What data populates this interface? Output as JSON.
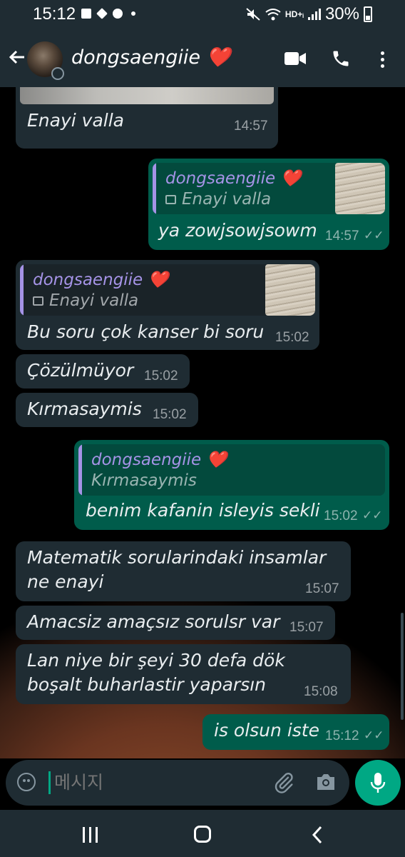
{
  "status_bar": {
    "time": "15:12",
    "network": "HD+ᵢ",
    "battery": "30%"
  },
  "header": {
    "contact_name": "dongsaengiie",
    "contact_emoji": "❤️"
  },
  "messages": [
    {
      "id": "m0",
      "dir": "in",
      "text": "Enayi valla",
      "time": "14:57"
    },
    {
      "id": "m1",
      "dir": "out",
      "reply_name": "dongsaengiie",
      "reply_emoji": "❤️",
      "reply_text": "Enayi valla",
      "text": "ya zowjsowjsowm",
      "time": "14:57"
    },
    {
      "id": "m2",
      "dir": "in",
      "reply_name": "dongsaengiie",
      "reply_emoji": "❤️",
      "reply_text": "Enayi valla",
      "text": "Bu soru çok kanser bi soru",
      "time": "15:02"
    },
    {
      "id": "m3",
      "dir": "in",
      "text": "Çözülmüyor",
      "time": "15:02"
    },
    {
      "id": "m4",
      "dir": "in",
      "text": "Kırmasaymis",
      "time": "15:02"
    },
    {
      "id": "m5",
      "dir": "out",
      "reply_name": "dongsaengiie",
      "reply_emoji": "❤️",
      "reply_text": "Kırmasaymis",
      "text": "benim kafanin isleyis sekli",
      "time": "15:02"
    },
    {
      "id": "m6",
      "dir": "in",
      "lines": [
        "Matematik sorularindaki insamlar",
        "ne enayi"
      ],
      "time": "15:07"
    },
    {
      "id": "m7",
      "dir": "in",
      "text": "Amacsiz amaçsız sorulsr var",
      "time": "15:07"
    },
    {
      "id": "m8",
      "dir": "in",
      "lines": [
        "Lan niye bir şeyi 30 defa dök",
        "boşalt buharlastir yaparsın"
      ],
      "time": "15:08"
    },
    {
      "id": "m9",
      "dir": "out",
      "text": "is olsun iste",
      "time": "15:12"
    }
  ],
  "input": {
    "placeholder": "메시지"
  },
  "colors": {
    "incoming": "#1f2c33",
    "outgoing": "#005c4b",
    "accent": "#00a884",
    "quote_name": "#a593e6"
  }
}
